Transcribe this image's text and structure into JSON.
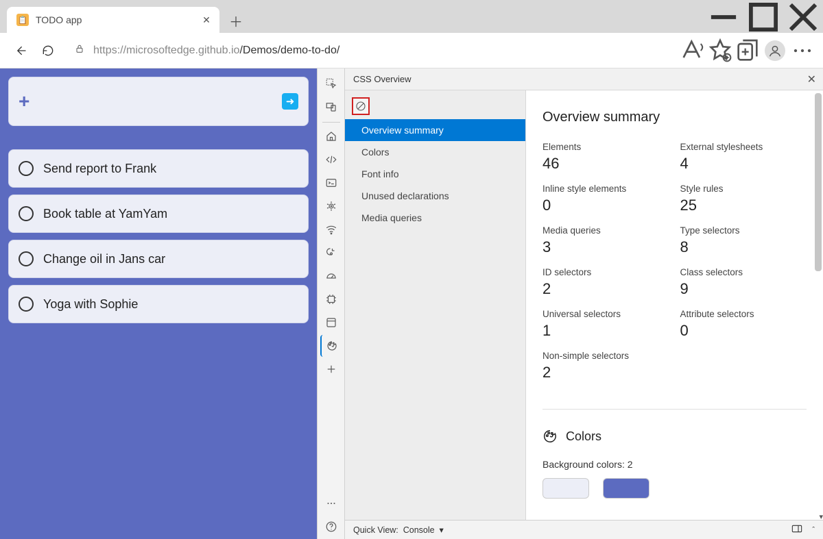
{
  "browser": {
    "tab_title": "TODO app",
    "url_host": "https://microsoftedge.github.io",
    "url_path": "/Demos/demo-to-do/"
  },
  "todo": {
    "items": [
      "Send report to Frank",
      "Book table at YamYam",
      "Change oil in Jans car",
      "Yoga with Sophie"
    ]
  },
  "css_overview": {
    "panel_title": "CSS Overview",
    "nav": {
      "overview_summary": "Overview summary",
      "colors": "Colors",
      "font_info": "Font info",
      "unused_declarations": "Unused declarations",
      "media_queries": "Media queries"
    },
    "summary": {
      "heading": "Overview summary",
      "stats": {
        "elements": {
          "label": "Elements",
          "value": "46"
        },
        "external_stylesheets": {
          "label": "External stylesheets",
          "value": "4"
        },
        "inline_style_elements": {
          "label": "Inline style elements",
          "value": "0"
        },
        "style_rules": {
          "label": "Style rules",
          "value": "25"
        },
        "media_queries": {
          "label": "Media queries",
          "value": "3"
        },
        "type_selectors": {
          "label": "Type selectors",
          "value": "8"
        },
        "id_selectors": {
          "label": "ID selectors",
          "value": "2"
        },
        "class_selectors": {
          "label": "Class selectors",
          "value": "9"
        },
        "universal_selectors": {
          "label": "Universal selectors",
          "value": "1"
        },
        "attribute_selectors": {
          "label": "Attribute selectors",
          "value": "0"
        },
        "non_simple_selectors": {
          "label": "Non-simple selectors",
          "value": "2"
        }
      },
      "colors_section": {
        "heading": "Colors",
        "background_label": "Background colors: 2",
        "swatches": [
          "#eceef7",
          "#5c6bc0"
        ]
      }
    }
  },
  "quickview": {
    "label": "Quick View:",
    "value": "Console"
  }
}
